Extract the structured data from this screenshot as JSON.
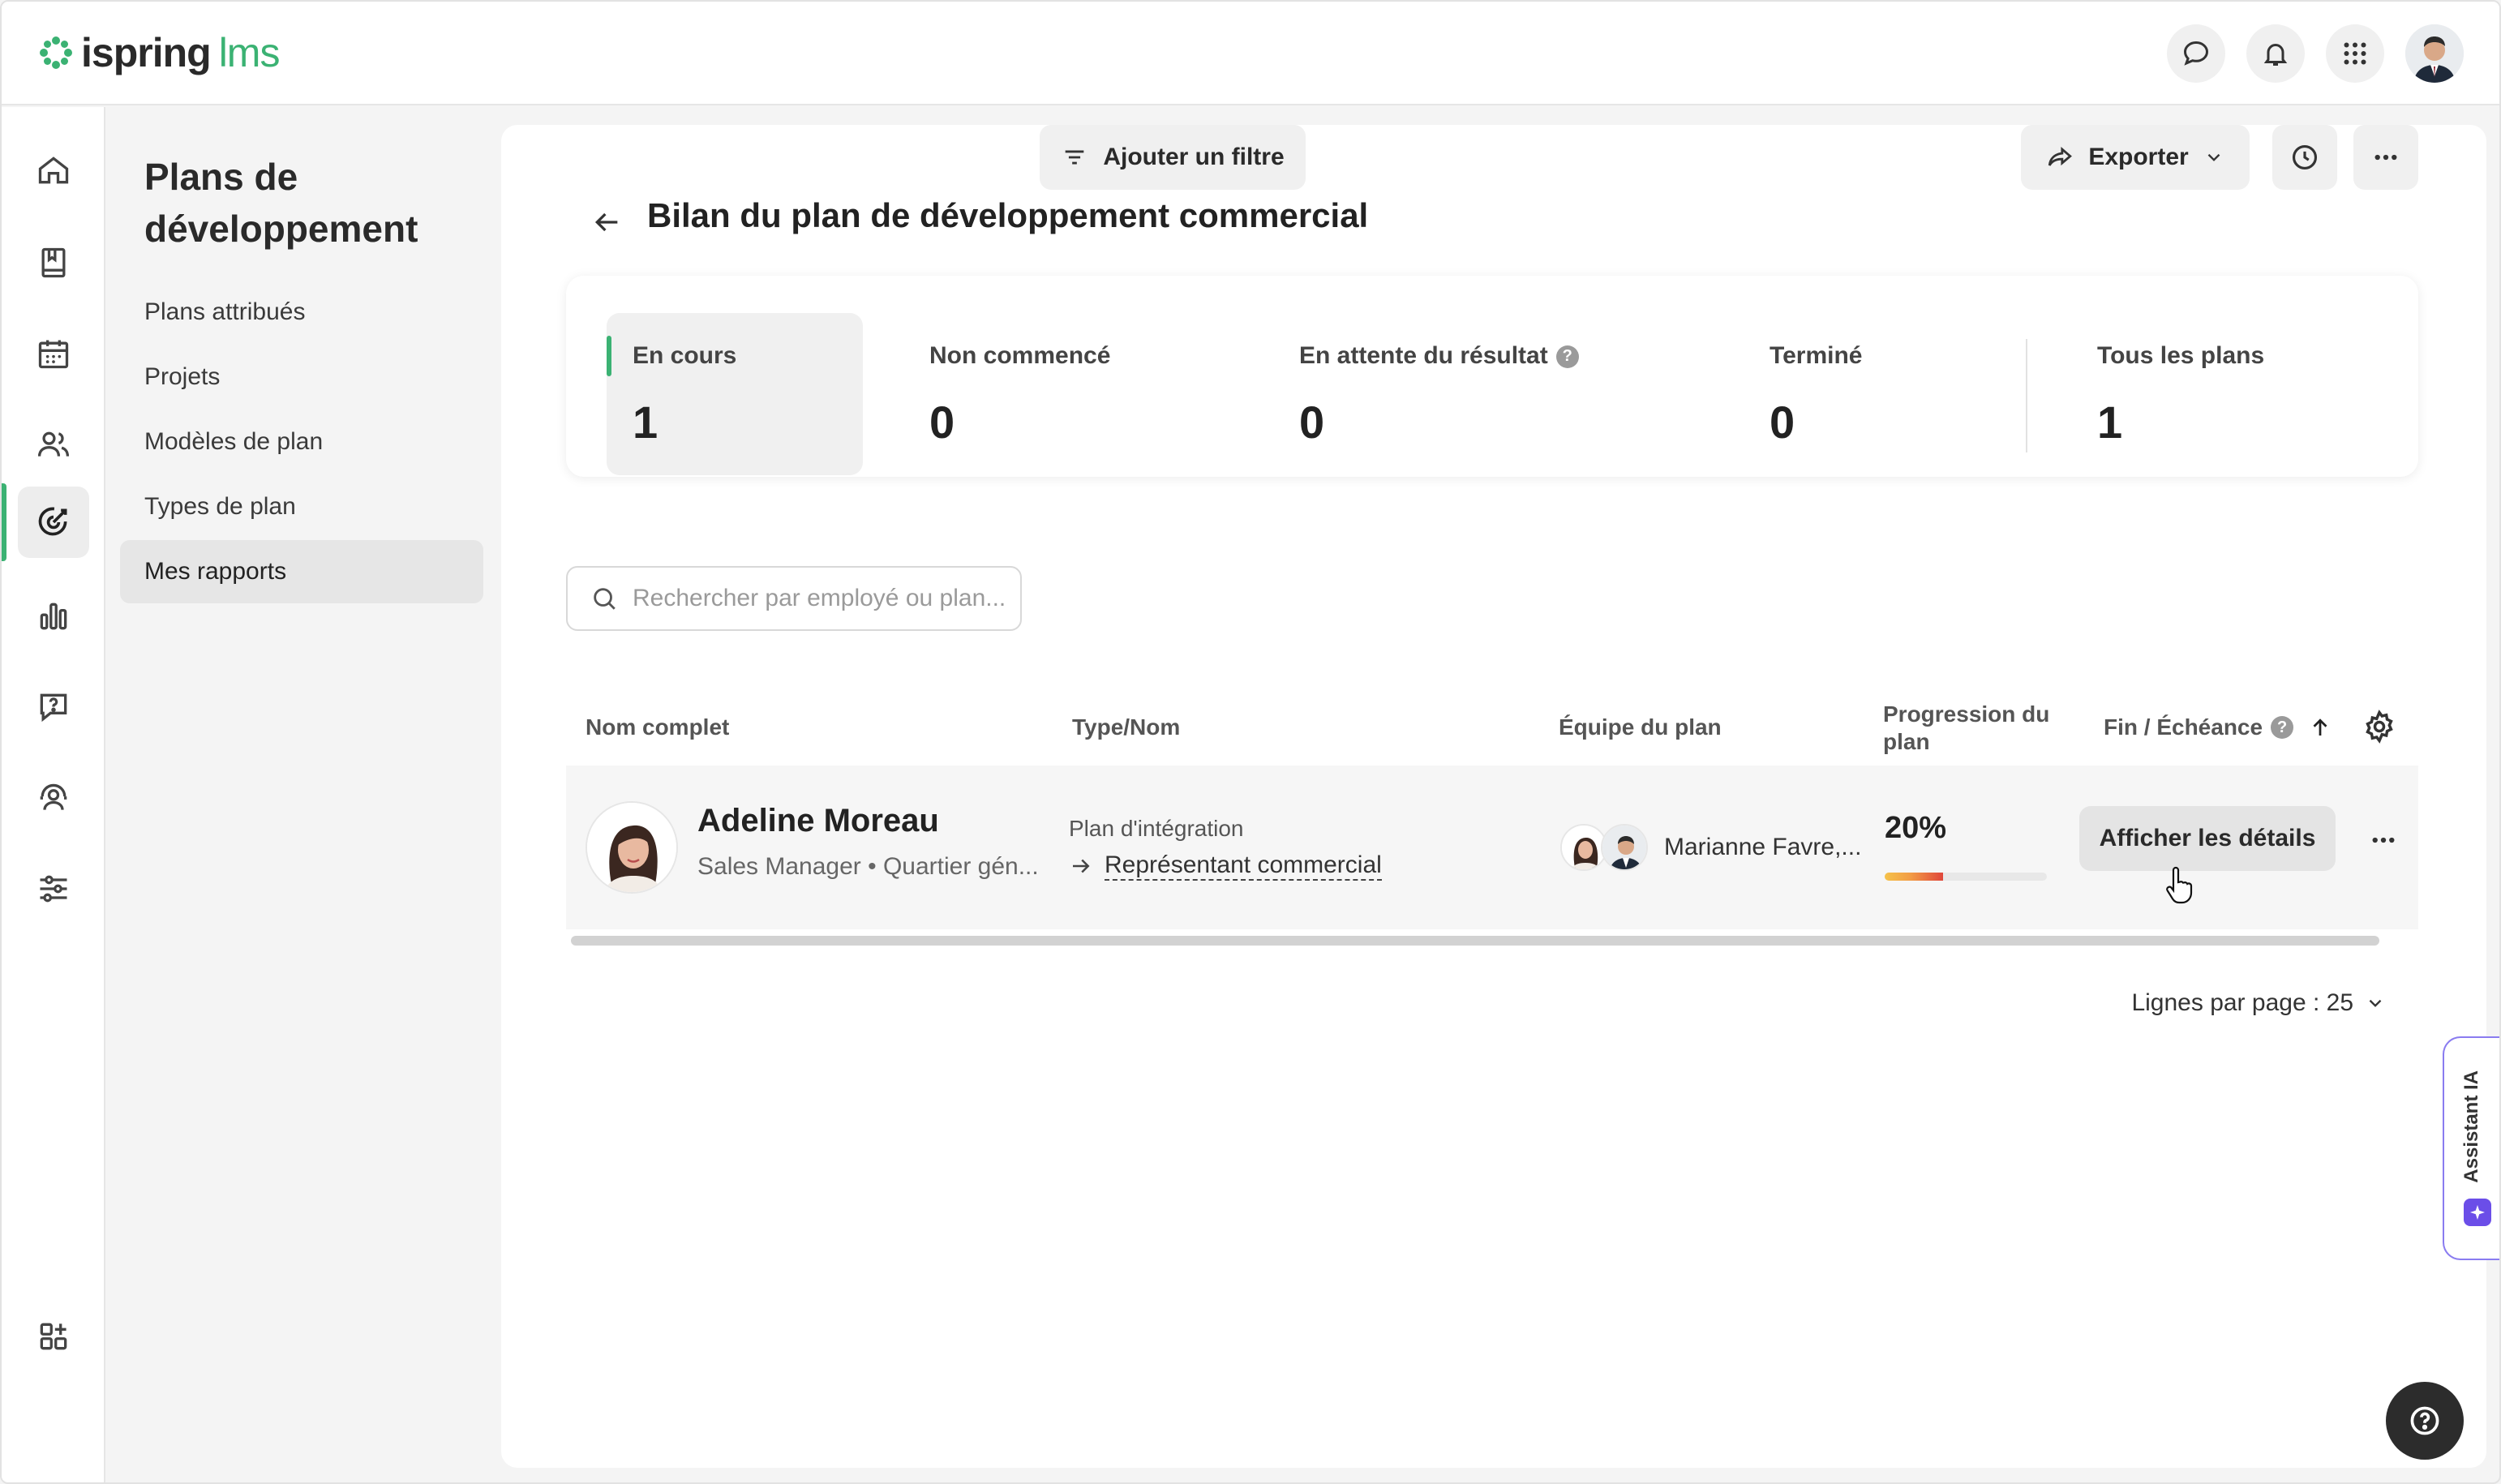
{
  "brand": {
    "name": "ispring",
    "product": "lms",
    "accent": "#3bb273"
  },
  "topbar": {
    "icons": [
      "chat-icon",
      "bell-icon",
      "apps-grid-icon"
    ],
    "avatar": "user-avatar"
  },
  "rail": {
    "items": [
      "home-icon",
      "book-icon",
      "calendar-icon",
      "people-icon",
      "target-icon",
      "bar-chart-icon",
      "question-bubble-icon",
      "support-person-icon",
      "sliders-icon",
      "add-widget-icon"
    ],
    "active": "target-icon"
  },
  "sidebar": {
    "title": "Plans de développement",
    "items": [
      {
        "label": "Plans attribués"
      },
      {
        "label": "Projets"
      },
      {
        "label": "Modèles de plan"
      },
      {
        "label": "Types de plan"
      },
      {
        "label": "Mes rapports",
        "active": true
      }
    ]
  },
  "page": {
    "title": "Bilan du plan de développement commercial"
  },
  "stats": [
    {
      "label": "En cours",
      "value": "1",
      "active": true
    },
    {
      "label": "Non commencé",
      "value": "0"
    },
    {
      "label": "En attente du résultat",
      "value": "0",
      "info": true
    },
    {
      "label": "Terminé",
      "value": "0"
    },
    {
      "label": "Tous les plans",
      "value": "1"
    }
  ],
  "toolbar": {
    "search_placeholder": "Rechercher par employé ou plan...",
    "filter_label": "Ajouter un filtre",
    "export_label": "Exporter"
  },
  "table": {
    "columns": [
      "Nom complet",
      "Type/Nom",
      "Équipe du plan",
      "Progression du plan",
      "Fin / Échéance"
    ],
    "rows": [
      {
        "name": "Adeline Moreau",
        "meta": "Sales Manager • Quartier gén...",
        "plan_type": "Plan d'intégration",
        "plan_name": "Représentant commercial",
        "team": "Marianne Favre,...",
        "progress_text": "20%",
        "progress": 0.2,
        "action": "Afficher les détails"
      }
    ],
    "rows_per_page": "Lignes par page : 25"
  },
  "ai_assistant": {
    "label": "Assistant IA"
  }
}
